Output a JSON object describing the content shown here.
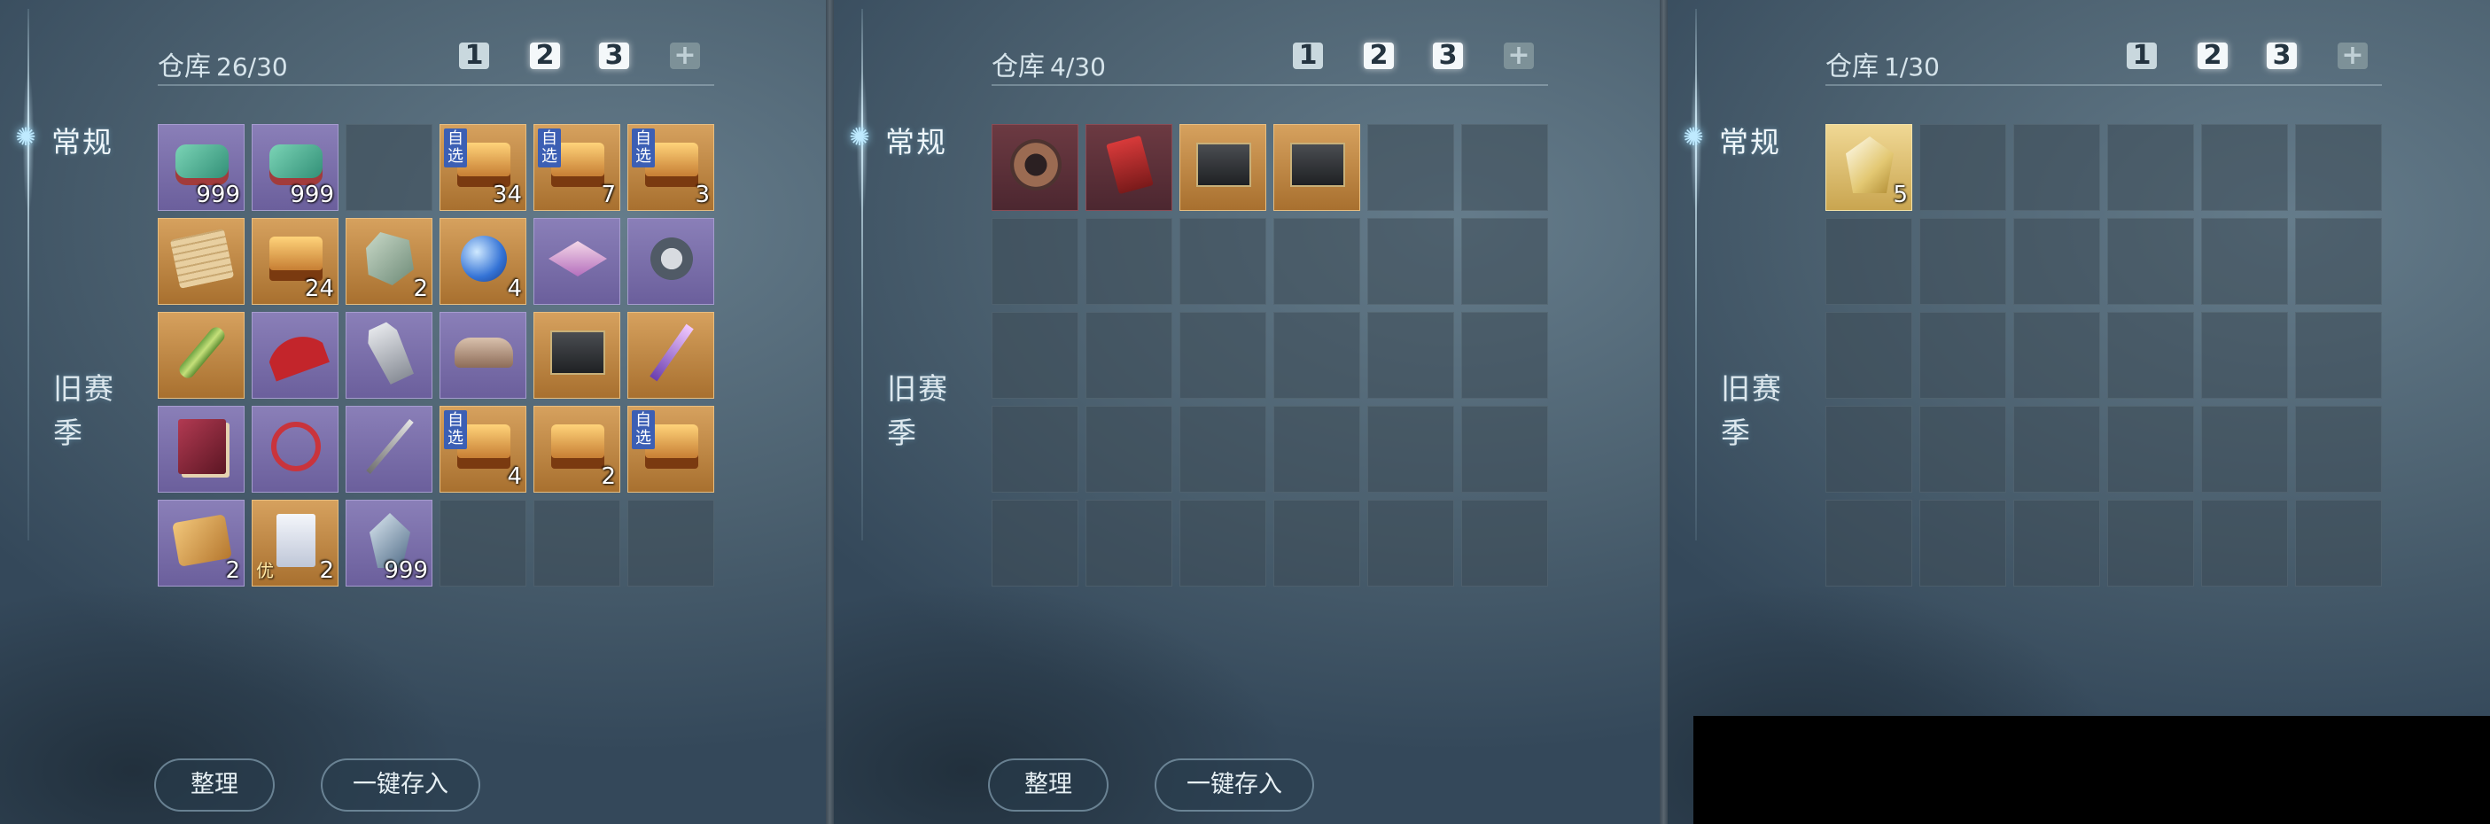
{
  "colors": {
    "accent": "#bfeaff",
    "panel_bg": "#4c6170",
    "badge_blue": "#3c5fb4"
  },
  "panels": [
    {
      "side_normal": "常规",
      "side_old": "旧赛季",
      "title": "仓库",
      "count": "26/30",
      "tabs": [
        {
          "label": "1",
          "active": false
        },
        {
          "label": "2",
          "active": true
        },
        {
          "label": "3",
          "active": true
        },
        {
          "label": "+",
          "active": false
        }
      ],
      "buttons": {
        "sort": "整理",
        "deposit": "一键存入"
      },
      "slots": [
        {
          "icon": "jade-seal-icon",
          "cls": "i-jade",
          "q": "q-purple",
          "qty": "999"
        },
        {
          "icon": "jade-seal-icon",
          "cls": "i-jade",
          "q": "q-purple",
          "qty": "999"
        },
        {
          "empty": true
        },
        {
          "icon": "treasure-chest-icon",
          "cls": "i-chest",
          "q": "q-gold",
          "qty": "34",
          "badge": "自选"
        },
        {
          "icon": "treasure-chest-icon",
          "cls": "i-chest",
          "q": "q-gold",
          "qty": "7",
          "badge": "自选"
        },
        {
          "icon": "treasure-chest-icon",
          "cls": "i-chest",
          "q": "q-gold",
          "qty": "3",
          "badge": "自选"
        },
        {
          "icon": "scroll-icon",
          "cls": "i-scroll",
          "q": "q-gold",
          "qty": ""
        },
        {
          "icon": "treasure-chest-icon",
          "cls": "i-chest",
          "q": "q-gold",
          "qty": "24"
        },
        {
          "icon": "ore-rock-icon",
          "cls": "i-rock",
          "q": "q-gold",
          "qty": "2"
        },
        {
          "icon": "blue-orb-icon",
          "cls": "i-orb",
          "q": "q-gold",
          "qty": "4"
        },
        {
          "icon": "glowing-crystal-icon",
          "cls": "i-glow",
          "q": "q-purple",
          "qty": ""
        },
        {
          "icon": "mechanism-upgrade-icon",
          "cls": "i-mech",
          "q": "q-purple",
          "qty": ""
        },
        {
          "icon": "bamboo-tube-icon",
          "cls": "i-bamboo",
          "q": "q-gold",
          "qty": ""
        },
        {
          "icon": "red-umbrella-icon",
          "cls": "i-umbrella",
          "q": "q-purple",
          "qty": ""
        },
        {
          "icon": "armor-icon",
          "cls": "i-armor",
          "q": "q-purple",
          "qty": ""
        },
        {
          "icon": "shoes-icon",
          "cls": "i-shoes",
          "q": "q-purple",
          "qty": ""
        },
        {
          "icon": "dark-box-icon",
          "cls": "i-box",
          "q": "q-gold",
          "qty": ""
        },
        {
          "icon": "purple-blade-icon",
          "cls": "i-blade",
          "q": "q-gold",
          "qty": ""
        },
        {
          "icon": "book-icon",
          "cls": "i-book",
          "q": "q-purple",
          "qty": ""
        },
        {
          "icon": "red-rope-icon",
          "cls": "i-rope",
          "q": "q-purple",
          "qty": ""
        },
        {
          "icon": "sword-icon",
          "cls": "i-sword",
          "q": "q-purple",
          "qty": ""
        },
        {
          "icon": "treasure-chest-icon",
          "cls": "i-chest",
          "q": "q-gold",
          "qty": "4",
          "badge": "自选"
        },
        {
          "icon": "treasure-chest-icon",
          "cls": "i-chest",
          "q": "q-gold",
          "qty": "2"
        },
        {
          "icon": "treasure-chest-icon",
          "cls": "i-chest",
          "q": "q-gold",
          "qty": "",
          "badge": "自选"
        },
        {
          "icon": "map-scroll-icon",
          "cls": "i-map",
          "q": "q-purple",
          "qty": "2"
        },
        {
          "icon": "paper-scroll-icon",
          "cls": "i-paper",
          "q": "q-gold",
          "qty": "2",
          "badge2": "优"
        },
        {
          "icon": "crystal-shard-icon",
          "cls": "i-crystal",
          "q": "q-purple",
          "qty": "999"
        },
        {
          "empty": true
        },
        {
          "empty": true
        },
        {
          "empty": true
        }
      ]
    },
    {
      "side_normal": "常规",
      "side_old": "旧赛季",
      "title": "仓库",
      "count": "4/30",
      "tabs": [
        {
          "label": "1",
          "active": false
        },
        {
          "label": "2",
          "active": true
        },
        {
          "label": "3",
          "active": true
        },
        {
          "label": "+",
          "active": false
        }
      ],
      "buttons": {
        "sort": "整理",
        "deposit": "一键存入"
      },
      "slots": [
        {
          "icon": "bronze-coin-icon",
          "cls": "i-coin",
          "q": "q-red",
          "qty": ""
        },
        {
          "icon": "red-card-icon",
          "cls": "i-card",
          "q": "q-red",
          "qty": ""
        },
        {
          "icon": "dark-box-icon",
          "cls": "i-box",
          "q": "q-gold",
          "qty": ""
        },
        {
          "icon": "dark-box-icon",
          "cls": "i-box",
          "q": "q-gold",
          "qty": ""
        },
        {
          "empty": true
        },
        {
          "empty": true
        },
        {
          "empty": true
        },
        {
          "empty": true
        },
        {
          "empty": true
        },
        {
          "empty": true
        },
        {
          "empty": true
        },
        {
          "empty": true
        },
        {
          "empty": true
        },
        {
          "empty": true
        },
        {
          "empty": true
        },
        {
          "empty": true
        },
        {
          "empty": true
        },
        {
          "empty": true
        },
        {
          "empty": true
        },
        {
          "empty": true
        },
        {
          "empty": true
        },
        {
          "empty": true
        },
        {
          "empty": true
        },
        {
          "empty": true
        },
        {
          "empty": true
        },
        {
          "empty": true
        },
        {
          "empty": true
        },
        {
          "empty": true
        },
        {
          "empty": true
        },
        {
          "empty": true
        }
      ]
    },
    {
      "side_normal": "常规",
      "side_old": "旧赛季",
      "title": "仓库",
      "count": "1/30",
      "tabs": [
        {
          "label": "1",
          "active": false
        },
        {
          "label": "2",
          "active": true
        },
        {
          "label": "3",
          "active": true
        },
        {
          "label": "+",
          "active": false
        }
      ],
      "buttons": {
        "sort": "",
        "deposit": ""
      },
      "slots": [
        {
          "icon": "white-gem-icon",
          "cls": "i-gem",
          "q": "q-lgold",
          "qty": "5"
        },
        {
          "empty": true
        },
        {
          "empty": true
        },
        {
          "empty": true
        },
        {
          "empty": true
        },
        {
          "empty": true
        },
        {
          "empty": true
        },
        {
          "empty": true
        },
        {
          "empty": true
        },
        {
          "empty": true
        },
        {
          "empty": true
        },
        {
          "empty": true
        },
        {
          "empty": true
        },
        {
          "empty": true
        },
        {
          "empty": true
        },
        {
          "empty": true
        },
        {
          "empty": true
        },
        {
          "empty": true
        },
        {
          "empty": true
        },
        {
          "empty": true
        },
        {
          "empty": true
        },
        {
          "empty": true
        },
        {
          "empty": true
        },
        {
          "empty": true
        },
        {
          "empty": true
        },
        {
          "empty": true
        },
        {
          "empty": true
        },
        {
          "empty": true
        },
        {
          "empty": true
        },
        {
          "empty": true
        }
      ]
    }
  ]
}
